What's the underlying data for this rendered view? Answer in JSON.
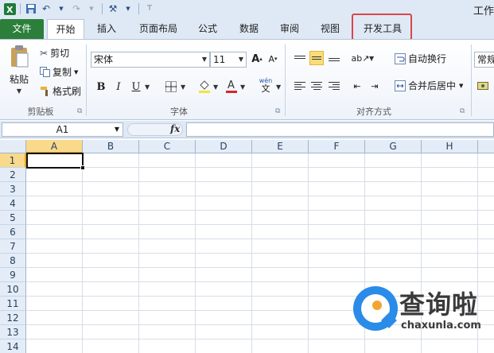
{
  "window": {
    "title": "工作"
  },
  "tabs": [
    {
      "label": "文件"
    },
    {
      "label": "开始"
    },
    {
      "label": "插入"
    },
    {
      "label": "页面布局"
    },
    {
      "label": "公式"
    },
    {
      "label": "数据"
    },
    {
      "label": "审阅"
    },
    {
      "label": "视图"
    },
    {
      "label": "开发工具"
    }
  ],
  "clipboard": {
    "paste": "粘贴",
    "cut": "剪切",
    "copy": "复制",
    "format_painter": "格式刷",
    "group": "剪贴板"
  },
  "font": {
    "name": "宋体",
    "size": "11",
    "bold": "B",
    "italic": "I",
    "underline": "U",
    "group": "字体",
    "wen": "wén"
  },
  "alignment": {
    "wrap_text": "自动换行",
    "merge_center": "合并后居中",
    "group": "对齐方式"
  },
  "number": {
    "format": "常规"
  },
  "formula_bar": {
    "name_box": "A1",
    "fx": "fx",
    "value": ""
  },
  "grid": {
    "columns": [
      "A",
      "B",
      "C",
      "D",
      "E",
      "F",
      "G",
      "H"
    ],
    "rows": [
      "1",
      "2",
      "3",
      "4",
      "5",
      "6",
      "7",
      "8",
      "9",
      "10",
      "11",
      "12",
      "13",
      "14"
    ],
    "active_cell": "A1"
  },
  "watermark": {
    "brand": "查询啦",
    "url": "chaxunla.com"
  },
  "colors": {
    "file_tab": "#2b7f3a",
    "highlight": "#d9454b",
    "selection": "#f9d98b"
  }
}
